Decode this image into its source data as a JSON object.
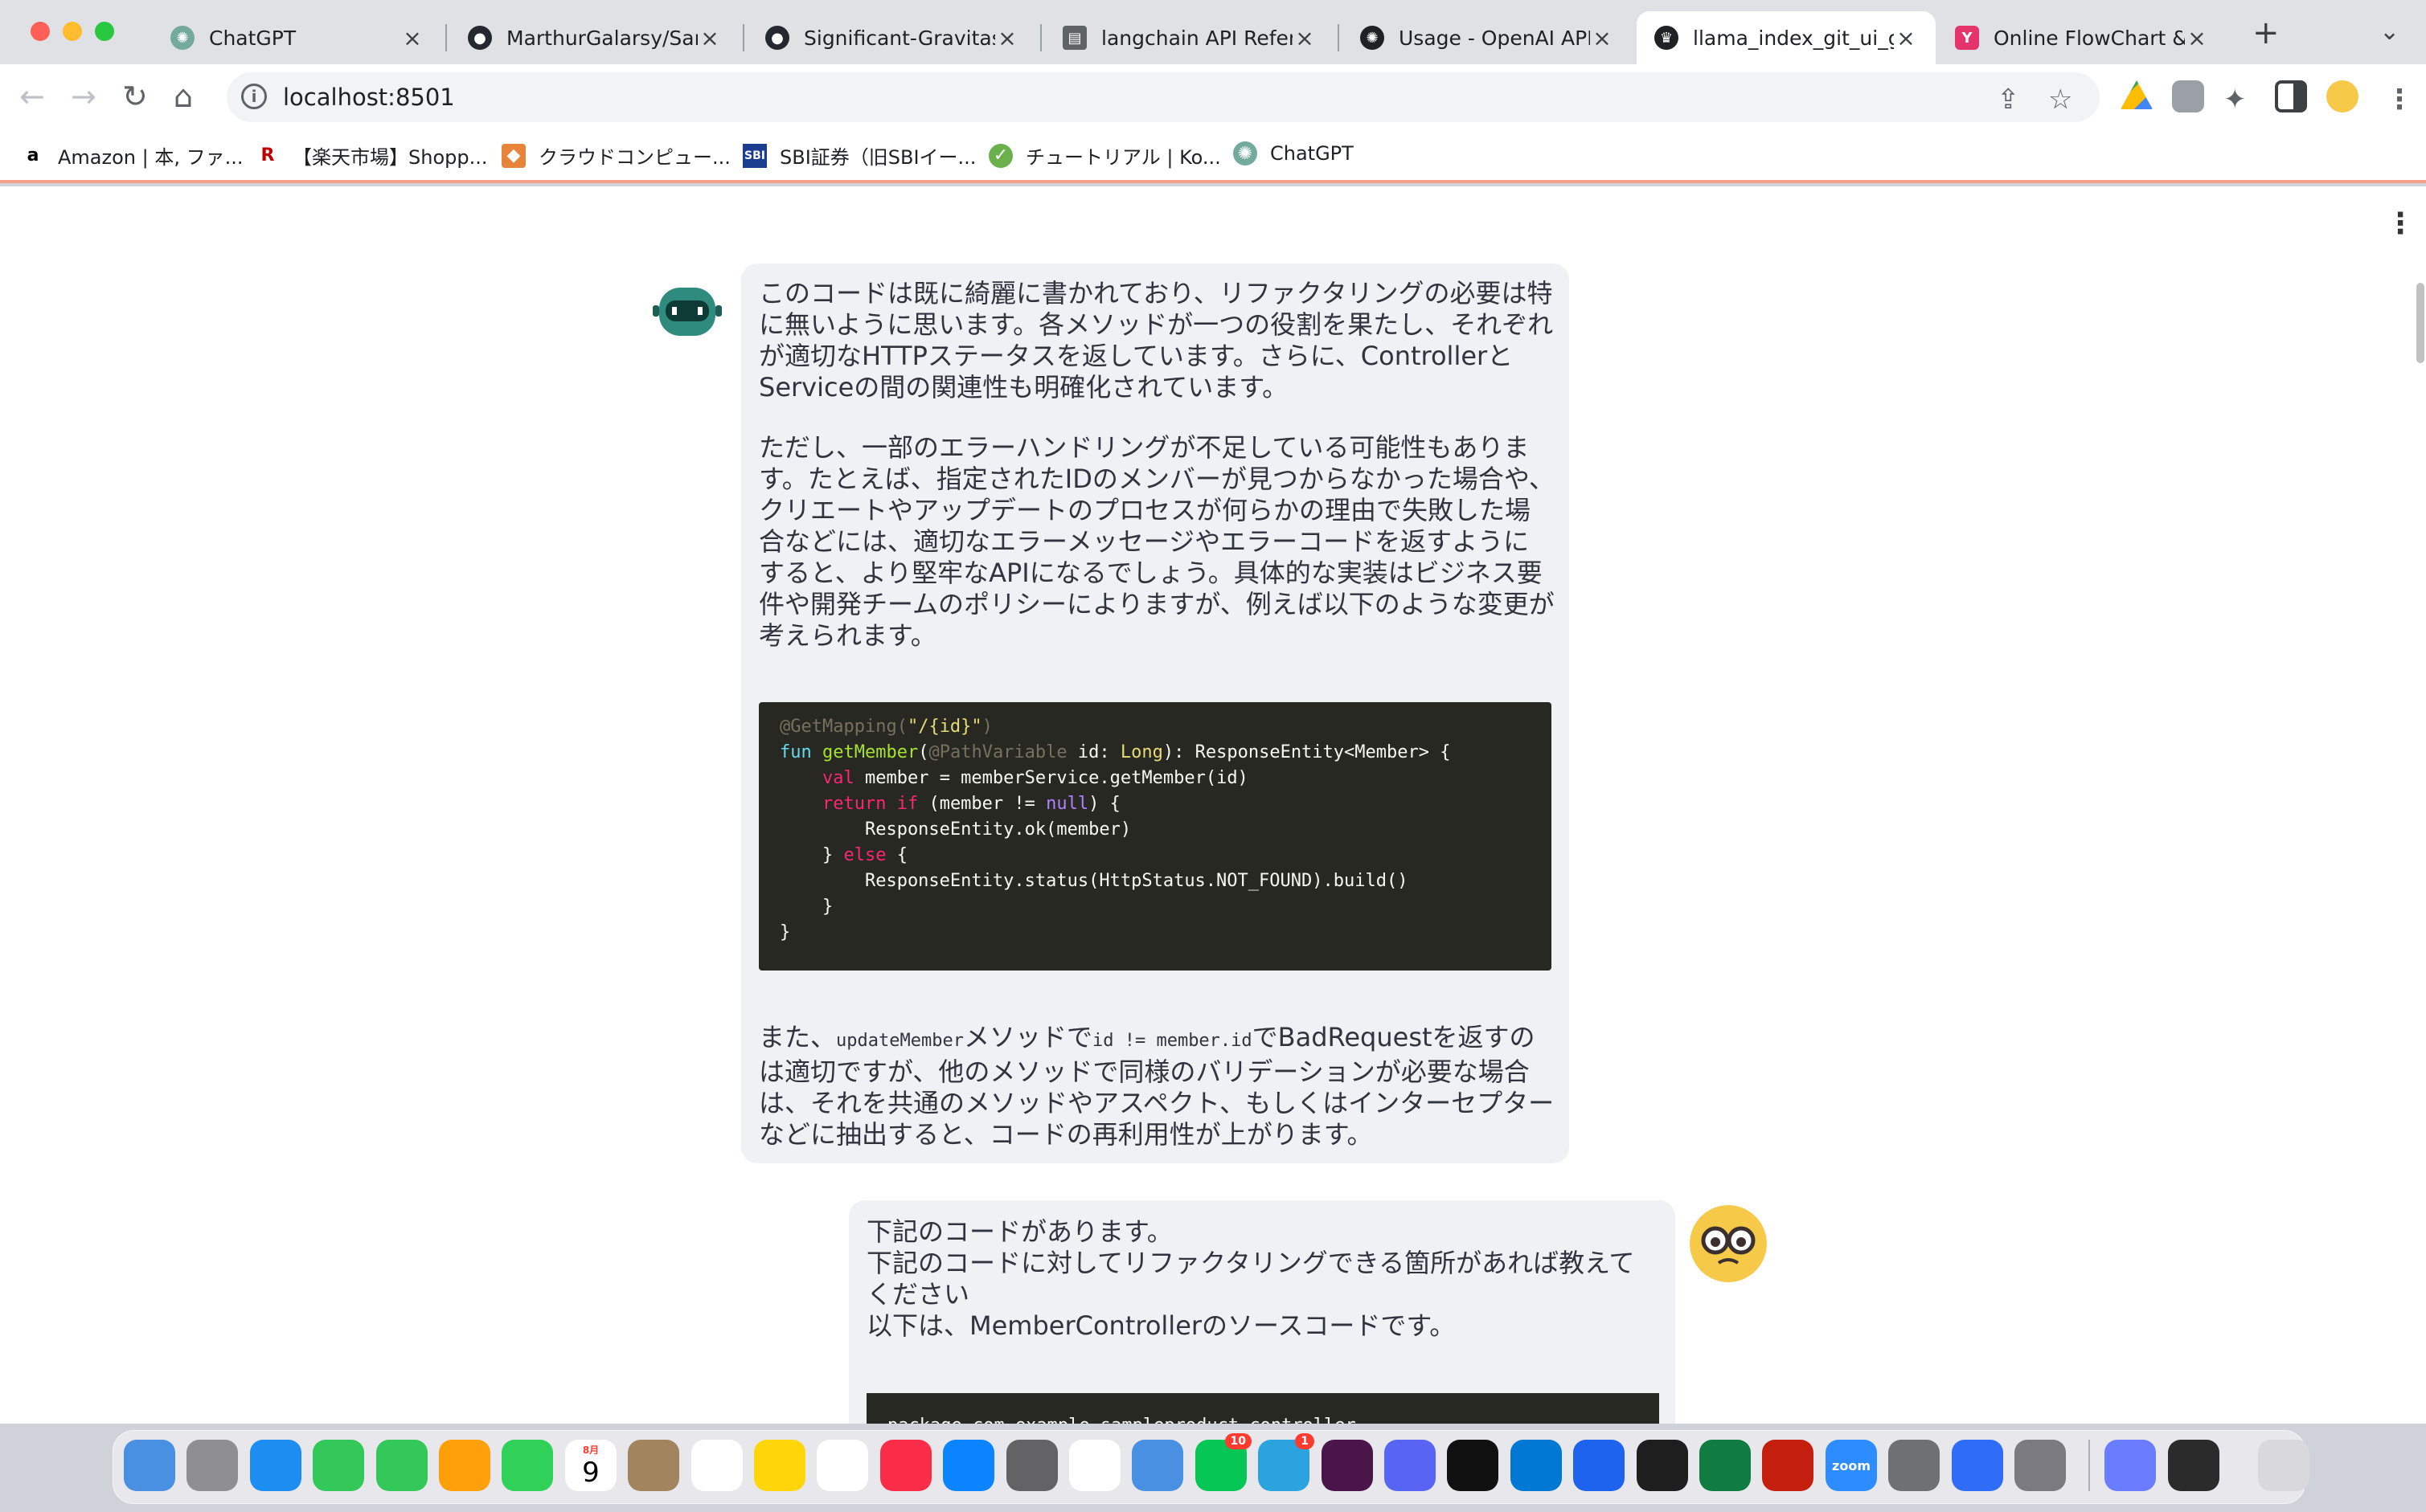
{
  "browser": {
    "tabs": [
      {
        "title": "ChatGPT",
        "icon": "chatgpt-icon"
      },
      {
        "title": "MarthurGalarsy/Samp",
        "icon": "github-icon"
      },
      {
        "title": "Significant-Gravitas/",
        "icon": "github-icon"
      },
      {
        "title": "langchain API Refere",
        "icon": "book-icon"
      },
      {
        "title": "Usage - OpenAI API",
        "icon": "openai-icon"
      },
      {
        "title": "llama_index_git_ui_g",
        "icon": "streamlit-icon",
        "active": true
      },
      {
        "title": "Online FlowChart & D",
        "icon": "flowchart-icon"
      }
    ],
    "url": "localhost:8501",
    "bookmarks": [
      {
        "label": "Amazon | 本, ファ...",
        "icon": "amazon-icon"
      },
      {
        "label": "【楽天市場】Shopp...",
        "icon": "rakuten-icon"
      },
      {
        "label": "クラウドコンピュー...",
        "icon": "aws-icon"
      },
      {
        "label": "SBI証券（旧SBIイー...",
        "icon": "sbi-icon"
      },
      {
        "label": "チュートリアル | Ko...",
        "icon": "kotlin-icon"
      },
      {
        "label": "ChatGPT",
        "icon": "chatgpt-icon"
      }
    ]
  },
  "chat": {
    "bot_message": {
      "para1": "このコードは既に綺麗に書かれており、リファクタリングの必要は特に無いように思います。各メソッドが一つの役割を果たし、それぞれが適切なHTTPステータスを返しています。さらに、ControllerとServiceの間の関連性も明確化されています。",
      "para2": "ただし、一部のエラーハンドリングが不足している可能性もあります。たとえば、指定されたIDのメンバーが見つからなかった場合や、クリエートやアップデートのプロセスが何らかの理由で失敗した場合などには、適切なエラーメッセージやエラーコードを返すようにすると、より堅牢なAPIになるでしょう。具体的な実装はビジネス要件や開発チームのポリシーによりますが、例えば以下のような変更が考えられます。",
      "code": [
        "@GetMapping(\"/{id}\")",
        "fun getMember(@PathVariable id: Long): ResponseEntity<Member> {",
        "    val member = memberService.getMember(id)",
        "    return if (member != null) {",
        "        ResponseEntity.ok(member)",
        "    } else {",
        "        ResponseEntity.status(HttpStatus.NOT_FOUND).build()",
        "    }",
        "}"
      ],
      "para3_prefix": "また、",
      "para3_code1": "updateMember",
      "para3_mid": "メソッドで",
      "para3_code2": "id != member.id",
      "para3_suffix": "でBadRequestを返すのは適切ですが、他のメソッドで同様のバリデーションが必要な場合は、それを共通のメソッドやアスペクト、もしくはインターセプターなどに抽出すると、コードの再利用性が上がります。"
    },
    "user_message": {
      "line1": "下記のコードがあります。",
      "line2": "下記のコードに対してリファクタリングできる箇所があれば教えてください",
      "line3": "以下は、MemberControllerのソースコードです。",
      "code_partial": "package com.example.sampleproduct.controller"
    }
  },
  "dock": {
    "calendar_month": "8月",
    "calendar_day": "9",
    "line_badge": "10",
    "telegram_badge": "1",
    "zoom_label": "zoom",
    "apps": [
      "finder-icon",
      "launchpad-icon",
      "safari-icon",
      "messages-icon",
      "maps-icon",
      "photos-icon",
      "facetime-icon",
      "calendar-icon",
      "contacts-icon",
      "reminders-icon",
      "notes-icon",
      "freeform-icon",
      "music-icon",
      "app-store-icon",
      "system-settings-icon",
      "chrome-icon",
      "mail-icon",
      "line-icon",
      "telegram-icon",
      "slack-icon",
      "discord-icon",
      "intellij-icon",
      "vscode-icon",
      "docker-icon",
      "terminal-icon",
      "excel-icon",
      "acrobat-icon",
      "zoom-icon",
      "scanner-icon",
      "ocr-icon",
      "screenshot-icon",
      "preview-icon",
      "activity-monitor-icon",
      "trash-icon"
    ]
  }
}
